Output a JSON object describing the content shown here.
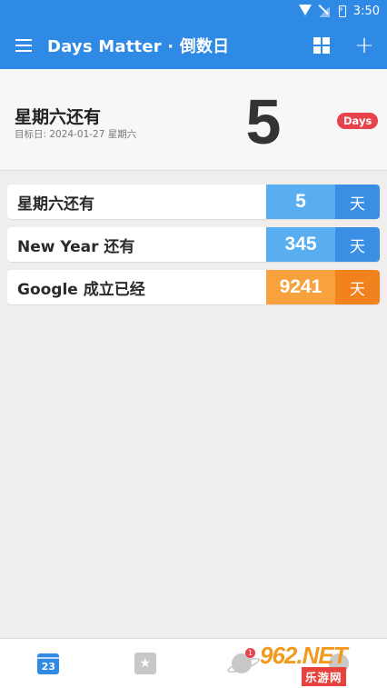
{
  "status_bar": {
    "time": "3:50",
    "icons": [
      "wifi-icon",
      "no-signal-icon",
      "battery-charging-icon"
    ]
  },
  "app_bar": {
    "title": "Days Matter · 倒数日",
    "menu_icon": "hamburger-menu-icon",
    "actions": [
      "grid-view-icon",
      "add-icon"
    ]
  },
  "hero": {
    "title": "星期六还有",
    "subtitle": "目标日: 2024-01-27 星期六",
    "count": "5",
    "badge": "Days",
    "badge_color": "#e8424d"
  },
  "events": [
    {
      "name": "星期六还有",
      "count": "5",
      "unit": "天",
      "color": "blue"
    },
    {
      "name": "New Year 还有",
      "count": "345",
      "unit": "天",
      "color": "blue"
    },
    {
      "name": "Google 成立已经",
      "count": "9241",
      "unit": "天",
      "color": "orange"
    }
  ],
  "colors": {
    "primary": "#2f8ae6",
    "blue_count": "#58aef0",
    "blue_unit": "#3a8fe4",
    "orange_count": "#f7a23c",
    "orange_unit": "#f2821e"
  },
  "bottom_nav": {
    "calendar_day": "23",
    "notification_count": "1",
    "items": [
      "calendar-icon",
      "star-box-icon",
      "planet-icon",
      "person-icon"
    ]
  },
  "watermark": {
    "main": "962.NET",
    "sub": "乐游网"
  }
}
